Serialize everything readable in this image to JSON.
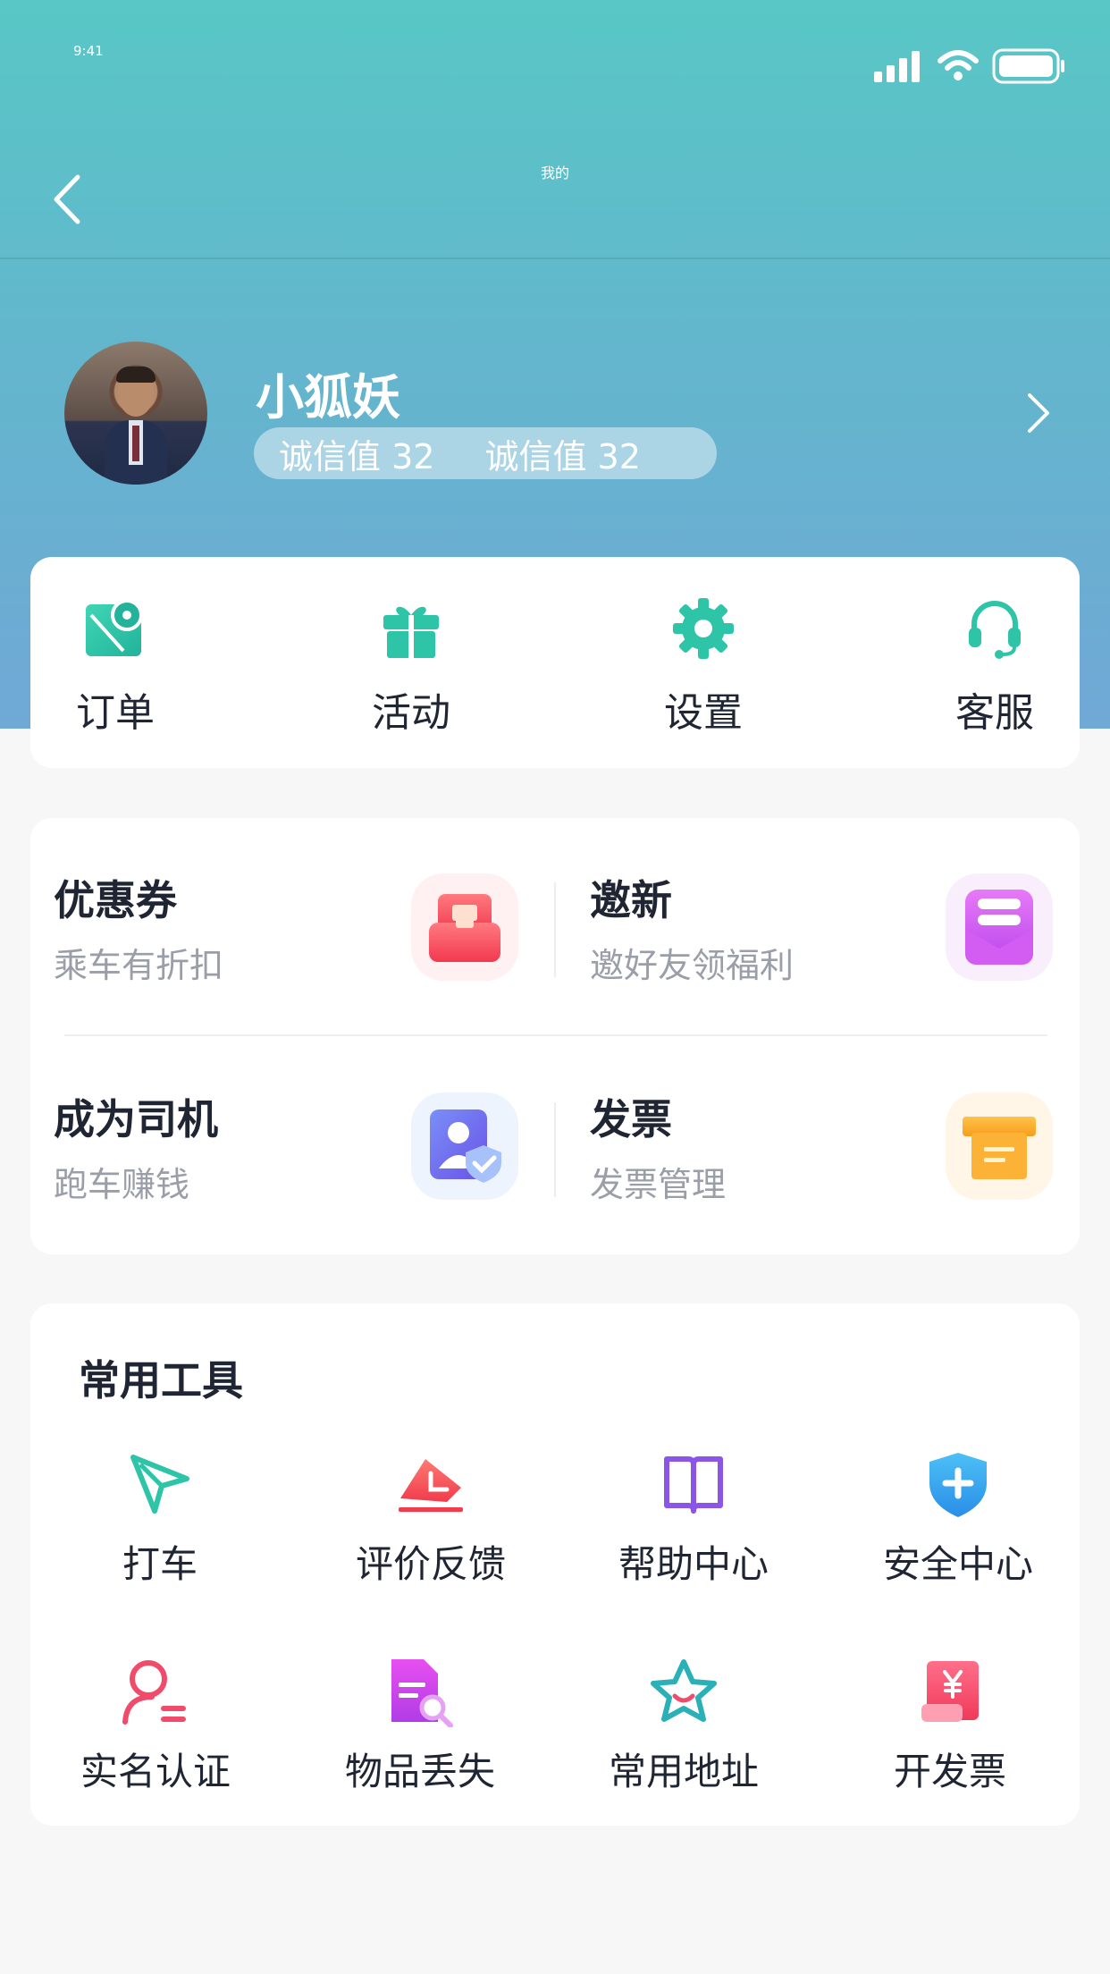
{
  "status": {
    "time": "9:41"
  },
  "nav": {
    "title": "我的"
  },
  "profile": {
    "name": "小狐妖",
    "scores": [
      "诚信值 32",
      "诚信值 32"
    ]
  },
  "quick_actions": [
    {
      "label": "订单",
      "icon": "map-pin-icon"
    },
    {
      "label": "活动",
      "icon": "gift-icon"
    },
    {
      "label": "设置",
      "icon": "gear-icon"
    },
    {
      "label": "客服",
      "icon": "headset-icon"
    }
  ],
  "promos": [
    {
      "title": "优惠券",
      "subtitle": "乘车有折扣",
      "icon": "coupon-bag-icon",
      "color": "#f5475c"
    },
    {
      "title": "邀新",
      "subtitle": "邀好友领福利",
      "icon": "invite-envelope-icon",
      "color": "#c94ff0"
    },
    {
      "title": "成为司机",
      "subtitle": "跑车赚钱",
      "icon": "driver-badge-icon",
      "color": "#6d7ef5"
    },
    {
      "title": "发票",
      "subtitle": "发票管理",
      "icon": "invoice-box-icon",
      "color": "#f7a21f"
    }
  ],
  "tools": {
    "title": "常用工具",
    "items": [
      {
        "label": "打车",
        "icon": "paper-plane-icon"
      },
      {
        "label": "评价反馈",
        "icon": "feedback-icon"
      },
      {
        "label": "帮助中心",
        "icon": "book-icon"
      },
      {
        "label": "安全中心",
        "icon": "shield-icon"
      },
      {
        "label": "实名认证",
        "icon": "user-verify-icon"
      },
      {
        "label": "物品丢失",
        "icon": "lost-item-search-icon"
      },
      {
        "label": "常用地址",
        "icon": "star-address-icon"
      },
      {
        "label": "开发票",
        "icon": "receipt-yen-icon"
      }
    ]
  },
  "colors": {
    "header_gradient_top": "#58c7c5",
    "header_gradient_bottom": "#70a8d6",
    "accent_teal": "#2ec4a8",
    "page_bg": "#f7f7f7"
  }
}
